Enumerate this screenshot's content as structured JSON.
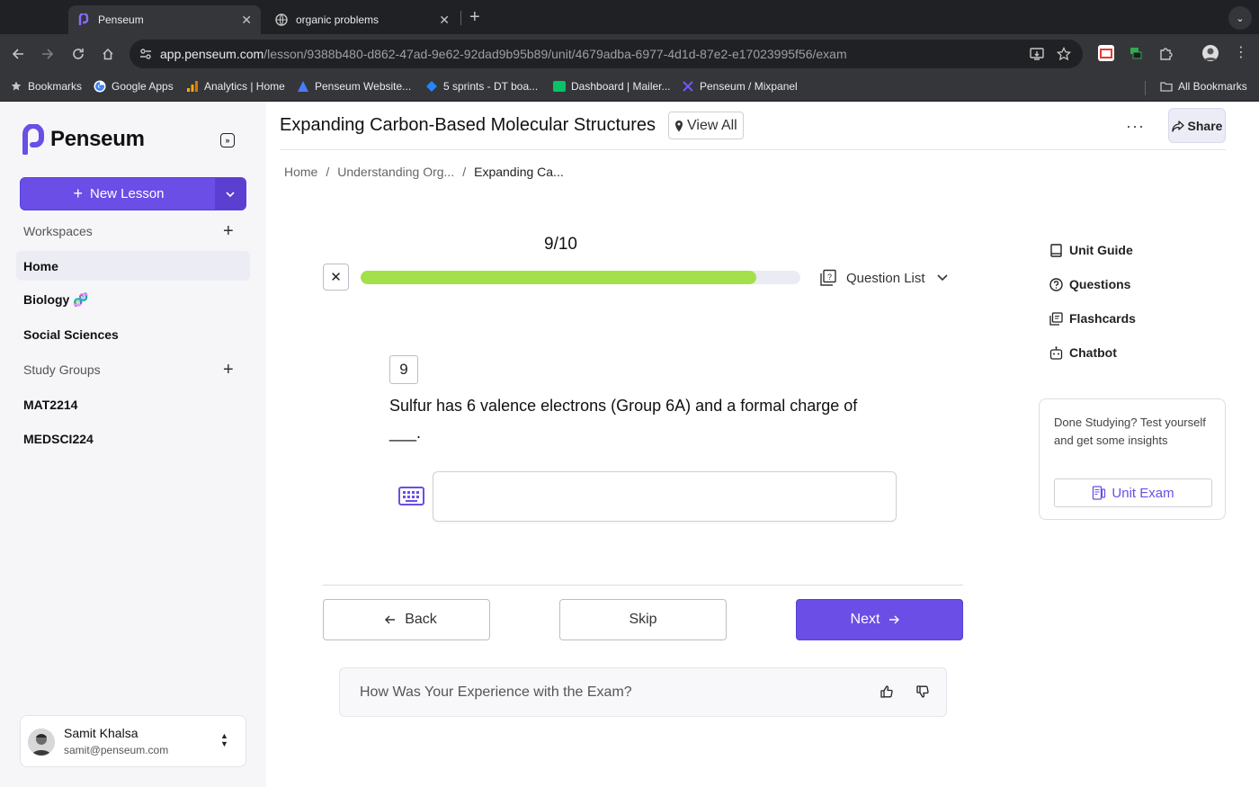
{
  "browser": {
    "tabs": [
      {
        "label": "Penseum",
        "active": true
      },
      {
        "label": "organic problems",
        "active": false
      }
    ],
    "url_host": "app.penseum.com",
    "url_path": "/lesson/9388b480-d862-47ad-9e62-92dad9b95b89/unit/4679adba-6977-4d1d-87e2-e17023995f56/exam",
    "bookmarks": [
      {
        "label": "Bookmarks",
        "icon": "star-icon"
      },
      {
        "label": "Google Apps",
        "icon": "google-icon"
      },
      {
        "label": "Analytics | Home",
        "icon": "analytics-icon"
      },
      {
        "label": "Penseum Website...",
        "icon": "penseum-website-icon"
      },
      {
        "label": "5 sprints - DT boa...",
        "icon": "jira-icon"
      },
      {
        "label": "Dashboard | Mailer...",
        "icon": "mailerlite-icon"
      },
      {
        "label": "Penseum / Mixpanel",
        "icon": "mixpanel-icon"
      }
    ],
    "all_bookmarks": "All Bookmarks"
  },
  "sidebar": {
    "logo_text": "Penseum",
    "new_lesson_label": "New Lesson",
    "workspaces_label": "Workspaces",
    "workspace_items": [
      {
        "label": "Home",
        "active": true
      },
      {
        "label": "Biology 🧬",
        "active": false
      },
      {
        "label": "Social Sciences",
        "active": false
      }
    ],
    "study_groups_label": "Study Groups",
    "study_group_items": [
      {
        "label": "MAT2214"
      },
      {
        "label": "MEDSCI224"
      }
    ],
    "user": {
      "name": "Samit Khalsa",
      "email": "samit@penseum.com"
    }
  },
  "header": {
    "title": "Expanding Carbon-Based Molecular Structures",
    "view_all": "View All",
    "share": "Share",
    "more": "···"
  },
  "breadcrumb": {
    "items": [
      "Home",
      "Understanding Org...",
      "Expanding Ca..."
    ],
    "separator": "/"
  },
  "exam": {
    "progress_label": "9/10",
    "progress_current": 9,
    "progress_total": 10,
    "progress_fraction": 0.9,
    "question_list_label": "Question List",
    "question_number": "9",
    "question_text": "Sulfur has 6 valence electrons (Group 6A) and a formal charge of ___.",
    "answer_value": "",
    "back_label": "Back",
    "skip_label": "Skip",
    "next_label": "Next",
    "feedback_prompt": "How Was Your Experience with the Exam?"
  },
  "right_panel": {
    "items": [
      {
        "label": "Unit Guide",
        "icon": "book-icon"
      },
      {
        "label": "Questions",
        "icon": "question-icon"
      },
      {
        "label": "Flashcards",
        "icon": "flashcards-icon"
      },
      {
        "label": "Chatbot",
        "icon": "bot-icon"
      }
    ],
    "done_card_text": "Done Studying? Test yourself and get some insights",
    "unit_exam_label": "Unit Exam"
  },
  "colors": {
    "brand": "#6b4ee6",
    "progress": "#a4e04a",
    "sidebar_bg": "#f6f6f9"
  }
}
